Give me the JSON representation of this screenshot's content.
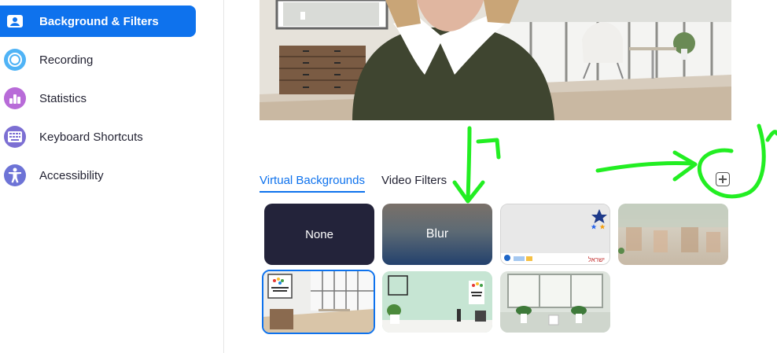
{
  "sidebar": {
    "items": [
      {
        "label": "Background & Filters",
        "icon": "person-frame-icon",
        "color": "#0e72ed",
        "active": true
      },
      {
        "label": "Recording",
        "icon": "record-icon",
        "color": "#4fb3f6"
      },
      {
        "label": "Statistics",
        "icon": "bar-chart-icon",
        "color": "#b86bd8"
      },
      {
        "label": "Keyboard Shortcuts",
        "icon": "keyboard-icon",
        "color": "#7c6fd3"
      },
      {
        "label": "Accessibility",
        "icon": "accessibility-icon",
        "color": "#6d73d6"
      }
    ]
  },
  "tabs": [
    {
      "label": "Virtual Backgrounds",
      "active": true
    },
    {
      "label": "Video Filters",
      "active": false
    }
  ],
  "backgrounds": {
    "none_label": "None",
    "blur_label": "Blur",
    "poster_text": "ישראל"
  },
  "annotations": {
    "color": "#22ee22"
  }
}
